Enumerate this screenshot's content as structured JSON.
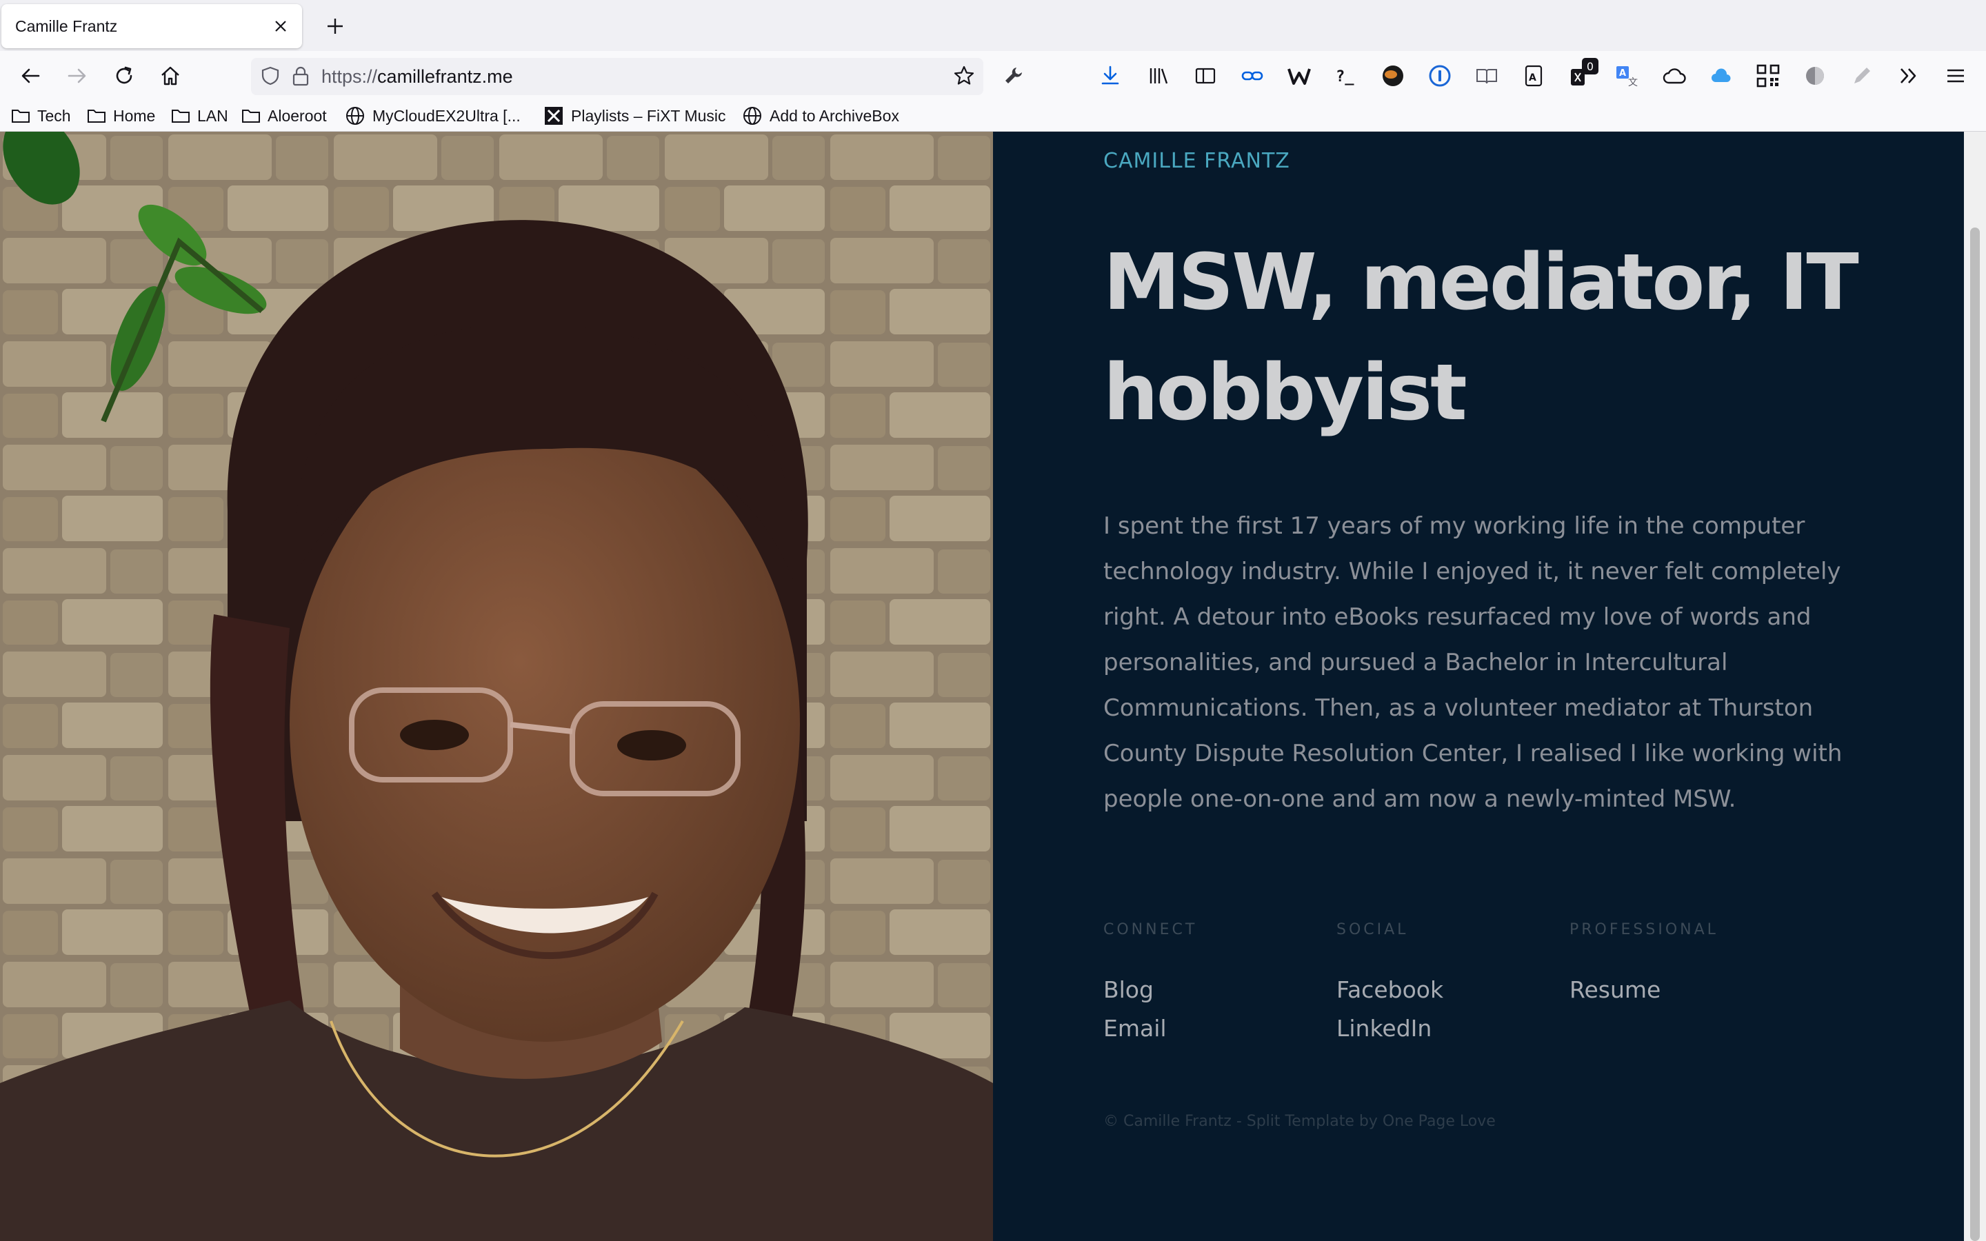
{
  "browser": {
    "tab_title": "Camille Frantz",
    "url_scheme": "https://",
    "url_host": "camillefrantz.me",
    "notification_badge": "0",
    "bookmarks": [
      {
        "label": "Tech",
        "icon": "folder-icon"
      },
      {
        "label": "Home",
        "icon": "folder-icon"
      },
      {
        "label": "LAN",
        "icon": "folder-icon"
      },
      {
        "label": "Aloeroot",
        "icon": "folder-icon"
      },
      {
        "label": "MyCloudEX2Ultra [...",
        "icon": "globe-icon"
      },
      {
        "label": "Playlists – FiXT Music",
        "icon": "fixt-icon"
      },
      {
        "label": "Add to ArchiveBox",
        "icon": "globe-icon"
      }
    ]
  },
  "page": {
    "brand": "CAMILLE FRANTZ",
    "headline": "MSW, mediator, IT hobbyist",
    "bio": "I spent the first 17 years of my working life in the computer technology industry. While I enjoyed it, it never felt completely right. A detour into eBooks resurfaced my love of words and personalities, and pursued a Bachelor in Intercultural Communications. Then, as a volunteer mediator at Thurston County Dispute Resolution Center, I realised I like working with people one-on-one and am now a newly-minted MSW.",
    "columns": [
      {
        "heading": "CONNECT",
        "links": [
          "Blog",
          "Email"
        ]
      },
      {
        "heading": "SOCIAL",
        "links": [
          "Facebook",
          "LinkedIn"
        ]
      },
      {
        "heading": "PROFESSIONAL",
        "links": [
          "Resume"
        ]
      }
    ],
    "footer": "© Camille Frantz - Split Template by One Page Love"
  },
  "colors": {
    "panel_bg": "#06192b",
    "brand_accent": "#4aa8c0",
    "headline": "#cfd0d2",
    "bio_text": "#8c9098"
  }
}
